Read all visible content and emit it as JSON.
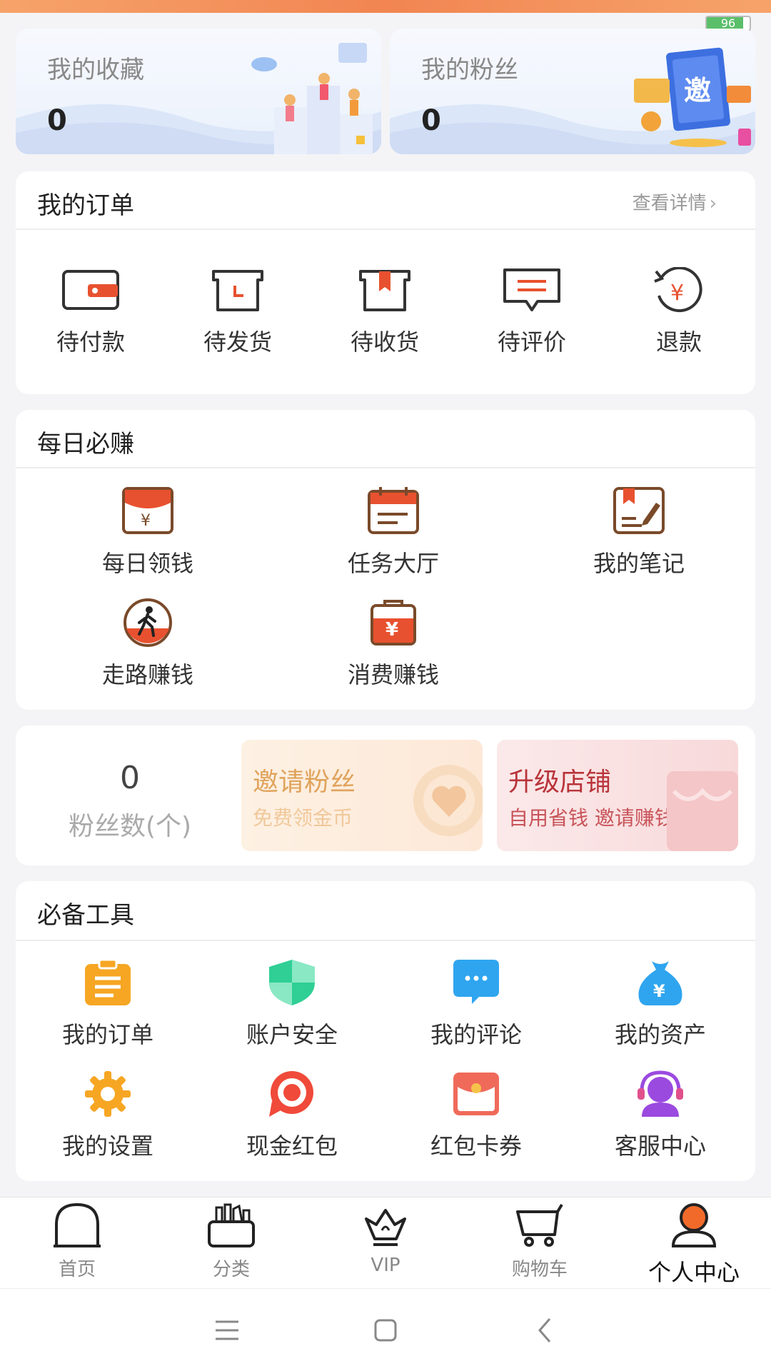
{
  "status": {
    "battery": "96"
  },
  "banners": {
    "favorites": {
      "title": "我的收藏",
      "count": "0"
    },
    "fans": {
      "title": "我的粉丝",
      "count": "0"
    },
    "invite_art_text": "邀"
  },
  "orders": {
    "title": "我的订单",
    "view_details": "查看详情",
    "items": [
      {
        "label": "待付款",
        "icon": "wallet-icon"
      },
      {
        "label": "待发货",
        "icon": "box-icon"
      },
      {
        "label": "待收货",
        "icon": "package-icon"
      },
      {
        "label": "待评价",
        "icon": "comment-icon"
      },
      {
        "label": "退款",
        "icon": "refund-icon"
      }
    ]
  },
  "daily": {
    "title": "每日必赚",
    "items": [
      {
        "label": "每日领钱",
        "icon": "red-envelope-icon"
      },
      {
        "label": "任务大厅",
        "icon": "calendar-icon"
      },
      {
        "label": "我的笔记",
        "icon": "notebook-icon"
      },
      {
        "label": "走路赚钱",
        "icon": "walking-icon"
      },
      {
        "label": "消费赚钱",
        "icon": "shopping-bag-icon"
      }
    ]
  },
  "fans_card": {
    "count": "0",
    "label": "粉丝数(个)",
    "invite": {
      "title": "邀请粉丝",
      "subtitle": "免费领金币"
    },
    "upgrade": {
      "title": "升级店铺",
      "subtitle": "自用省钱 邀请赚钱"
    }
  },
  "tools": {
    "title": "必备工具",
    "items": [
      {
        "label": "我的订单",
        "icon": "clipboard-icon"
      },
      {
        "label": "账户安全",
        "icon": "shield-icon"
      },
      {
        "label": "我的评论",
        "icon": "chat-bubble-icon"
      },
      {
        "label": "我的资产",
        "icon": "money-bag-icon"
      },
      {
        "label": "我的设置",
        "icon": "gear-icon"
      },
      {
        "label": "现金红包",
        "icon": "target-icon"
      },
      {
        "label": "红包卡券",
        "icon": "coupon-icon"
      },
      {
        "label": "客服中心",
        "icon": "headset-icon"
      }
    ]
  },
  "nav": {
    "items": [
      {
        "label": "首页",
        "icon": "home-icon"
      },
      {
        "label": "分类",
        "icon": "category-icon"
      },
      {
        "label": "VIP",
        "icon": "crown-icon"
      },
      {
        "label": "购物车",
        "icon": "cart-icon"
      },
      {
        "label": "个人中心",
        "icon": "profile-icon"
      }
    ],
    "active_index": 4
  },
  "colors": {
    "accent": "#e8512f",
    "brown": "#7a4a2a",
    "tool_orange": "#f6a623",
    "tool_green": "#2fcf96",
    "tool_blue": "#2fa5ef",
    "tool_red": "#f04a3a",
    "tool_purple": "#9b4ae0"
  }
}
